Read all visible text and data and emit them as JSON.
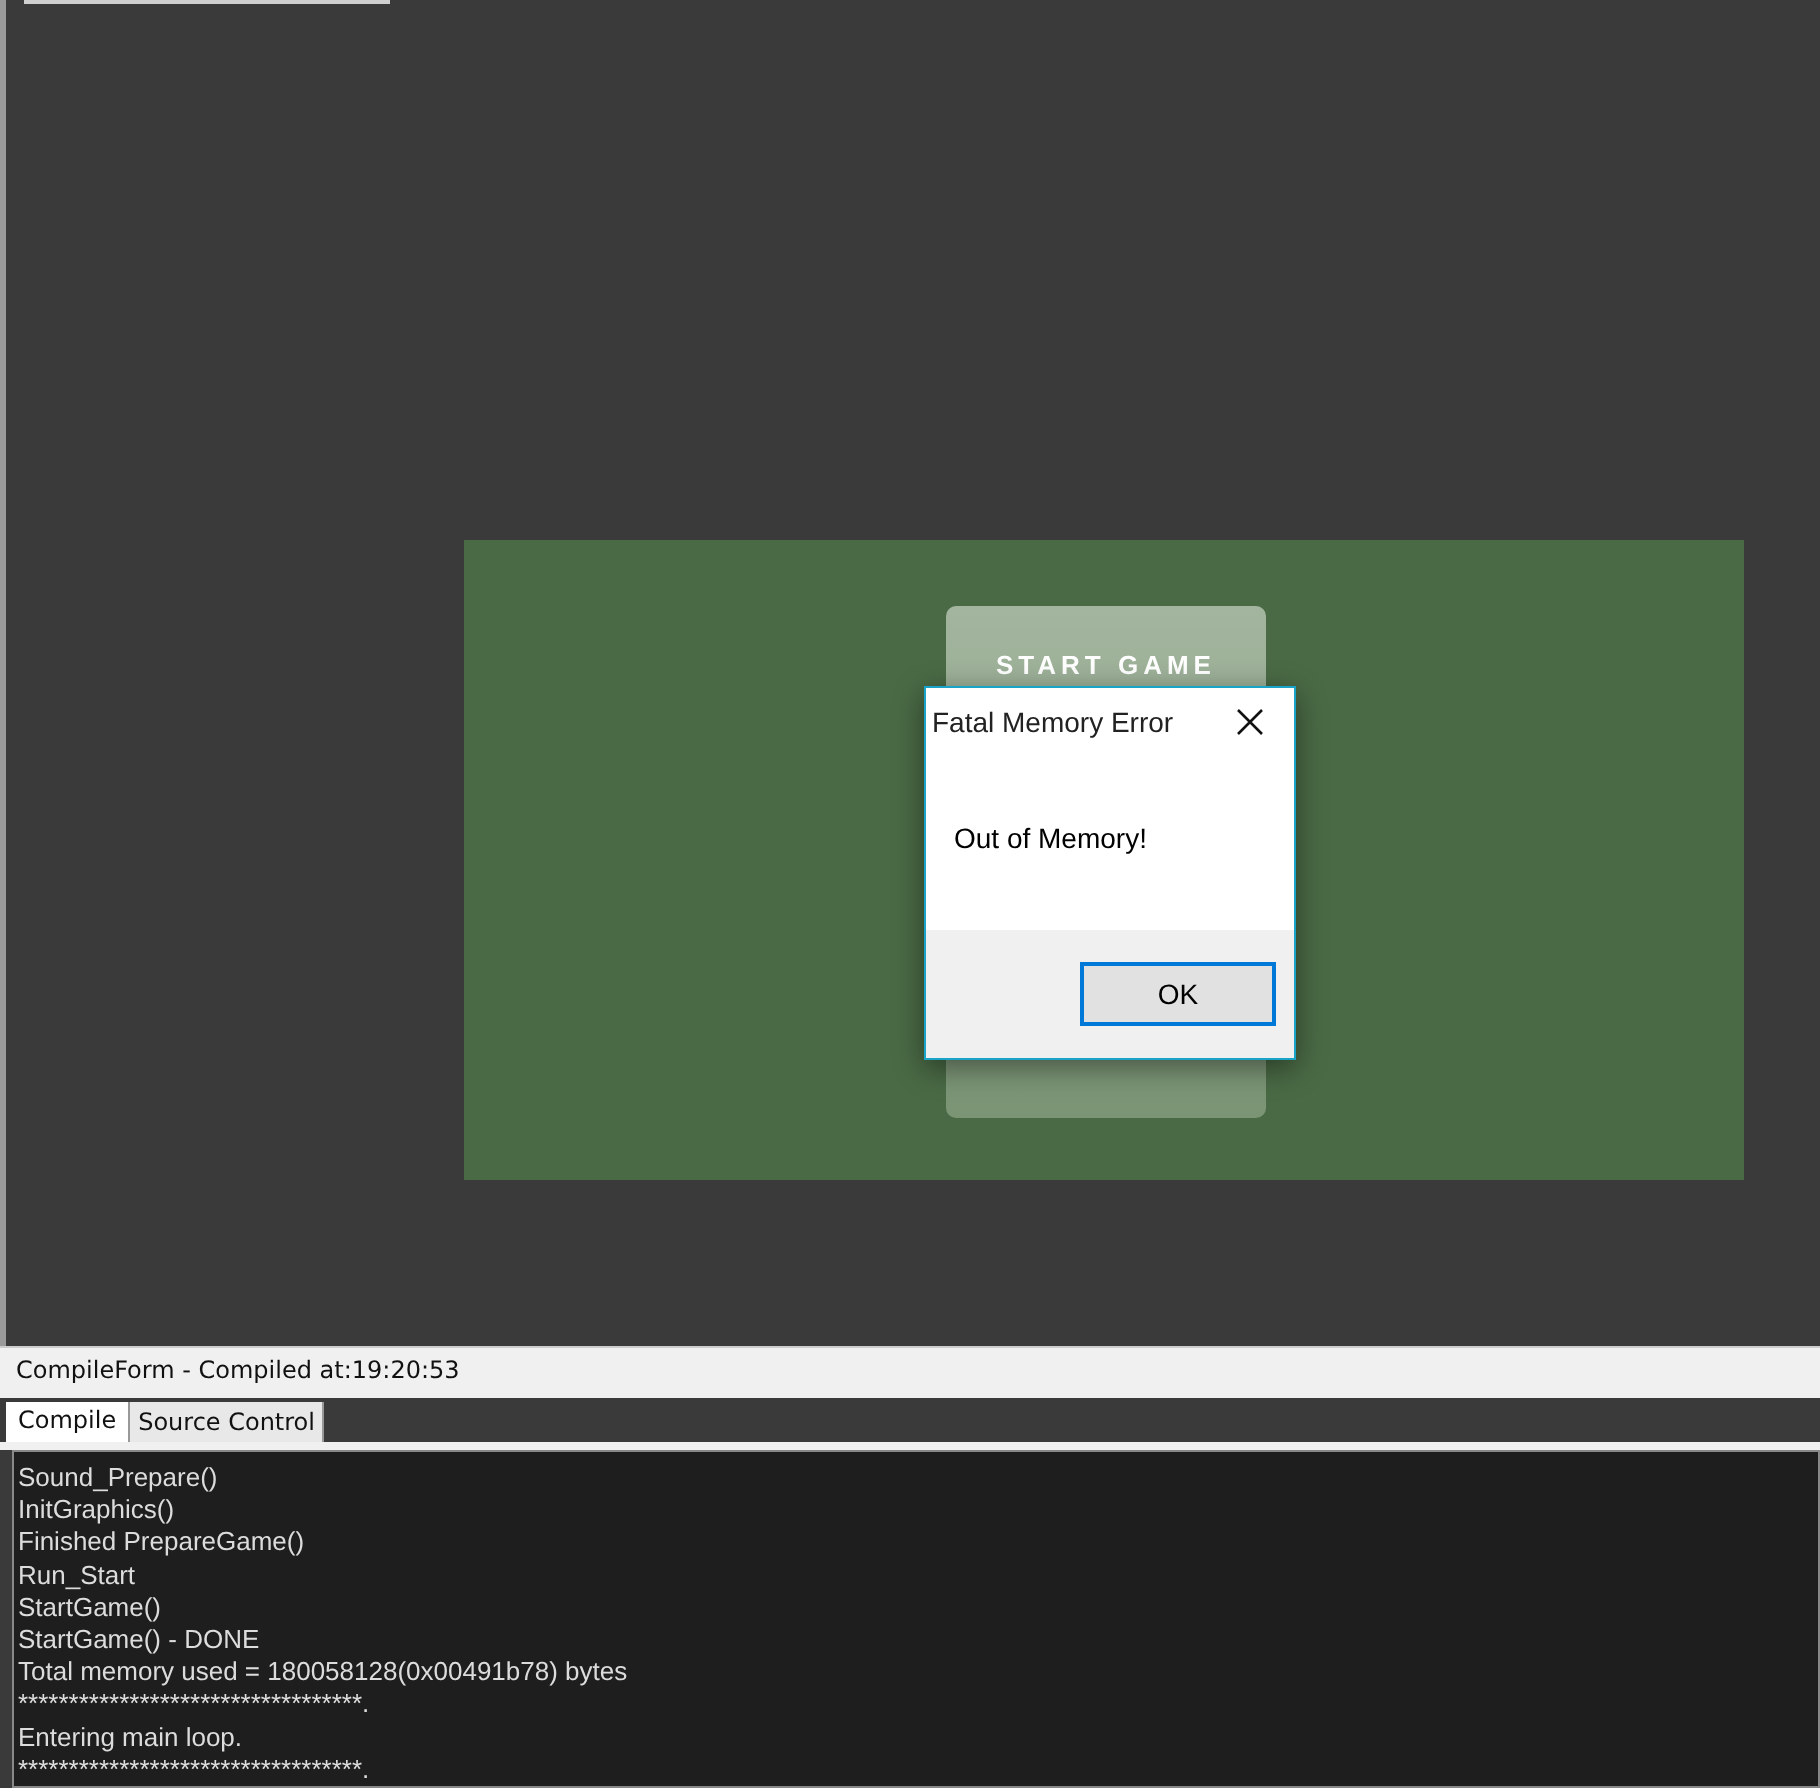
{
  "game_menu": {
    "buttons": [
      "START GAME"
    ]
  },
  "dialog": {
    "title": "Fatal Memory Error",
    "message": "Out of Memory!",
    "buttons": [
      {
        "label": "OK",
        "selected": true
      }
    ]
  },
  "compile_form": {
    "title": "CompileForm - Compiled at:19:20:53",
    "tabs": [
      {
        "label": "Compile",
        "selected": true
      },
      {
        "label": "Source Control",
        "selected": false
      }
    ],
    "output_lines": [
      "Sound_Prepare()",
      "InitGraphics()",
      "Finished PrepareGame()",
      "Run_Start",
      "StartGame()",
      "StartGame() - DONE",
      "Total memory used = 180058128(0x00491b78) bytes",
      "**********************************.",
      "Entering main loop.",
      "**********************************."
    ]
  }
}
